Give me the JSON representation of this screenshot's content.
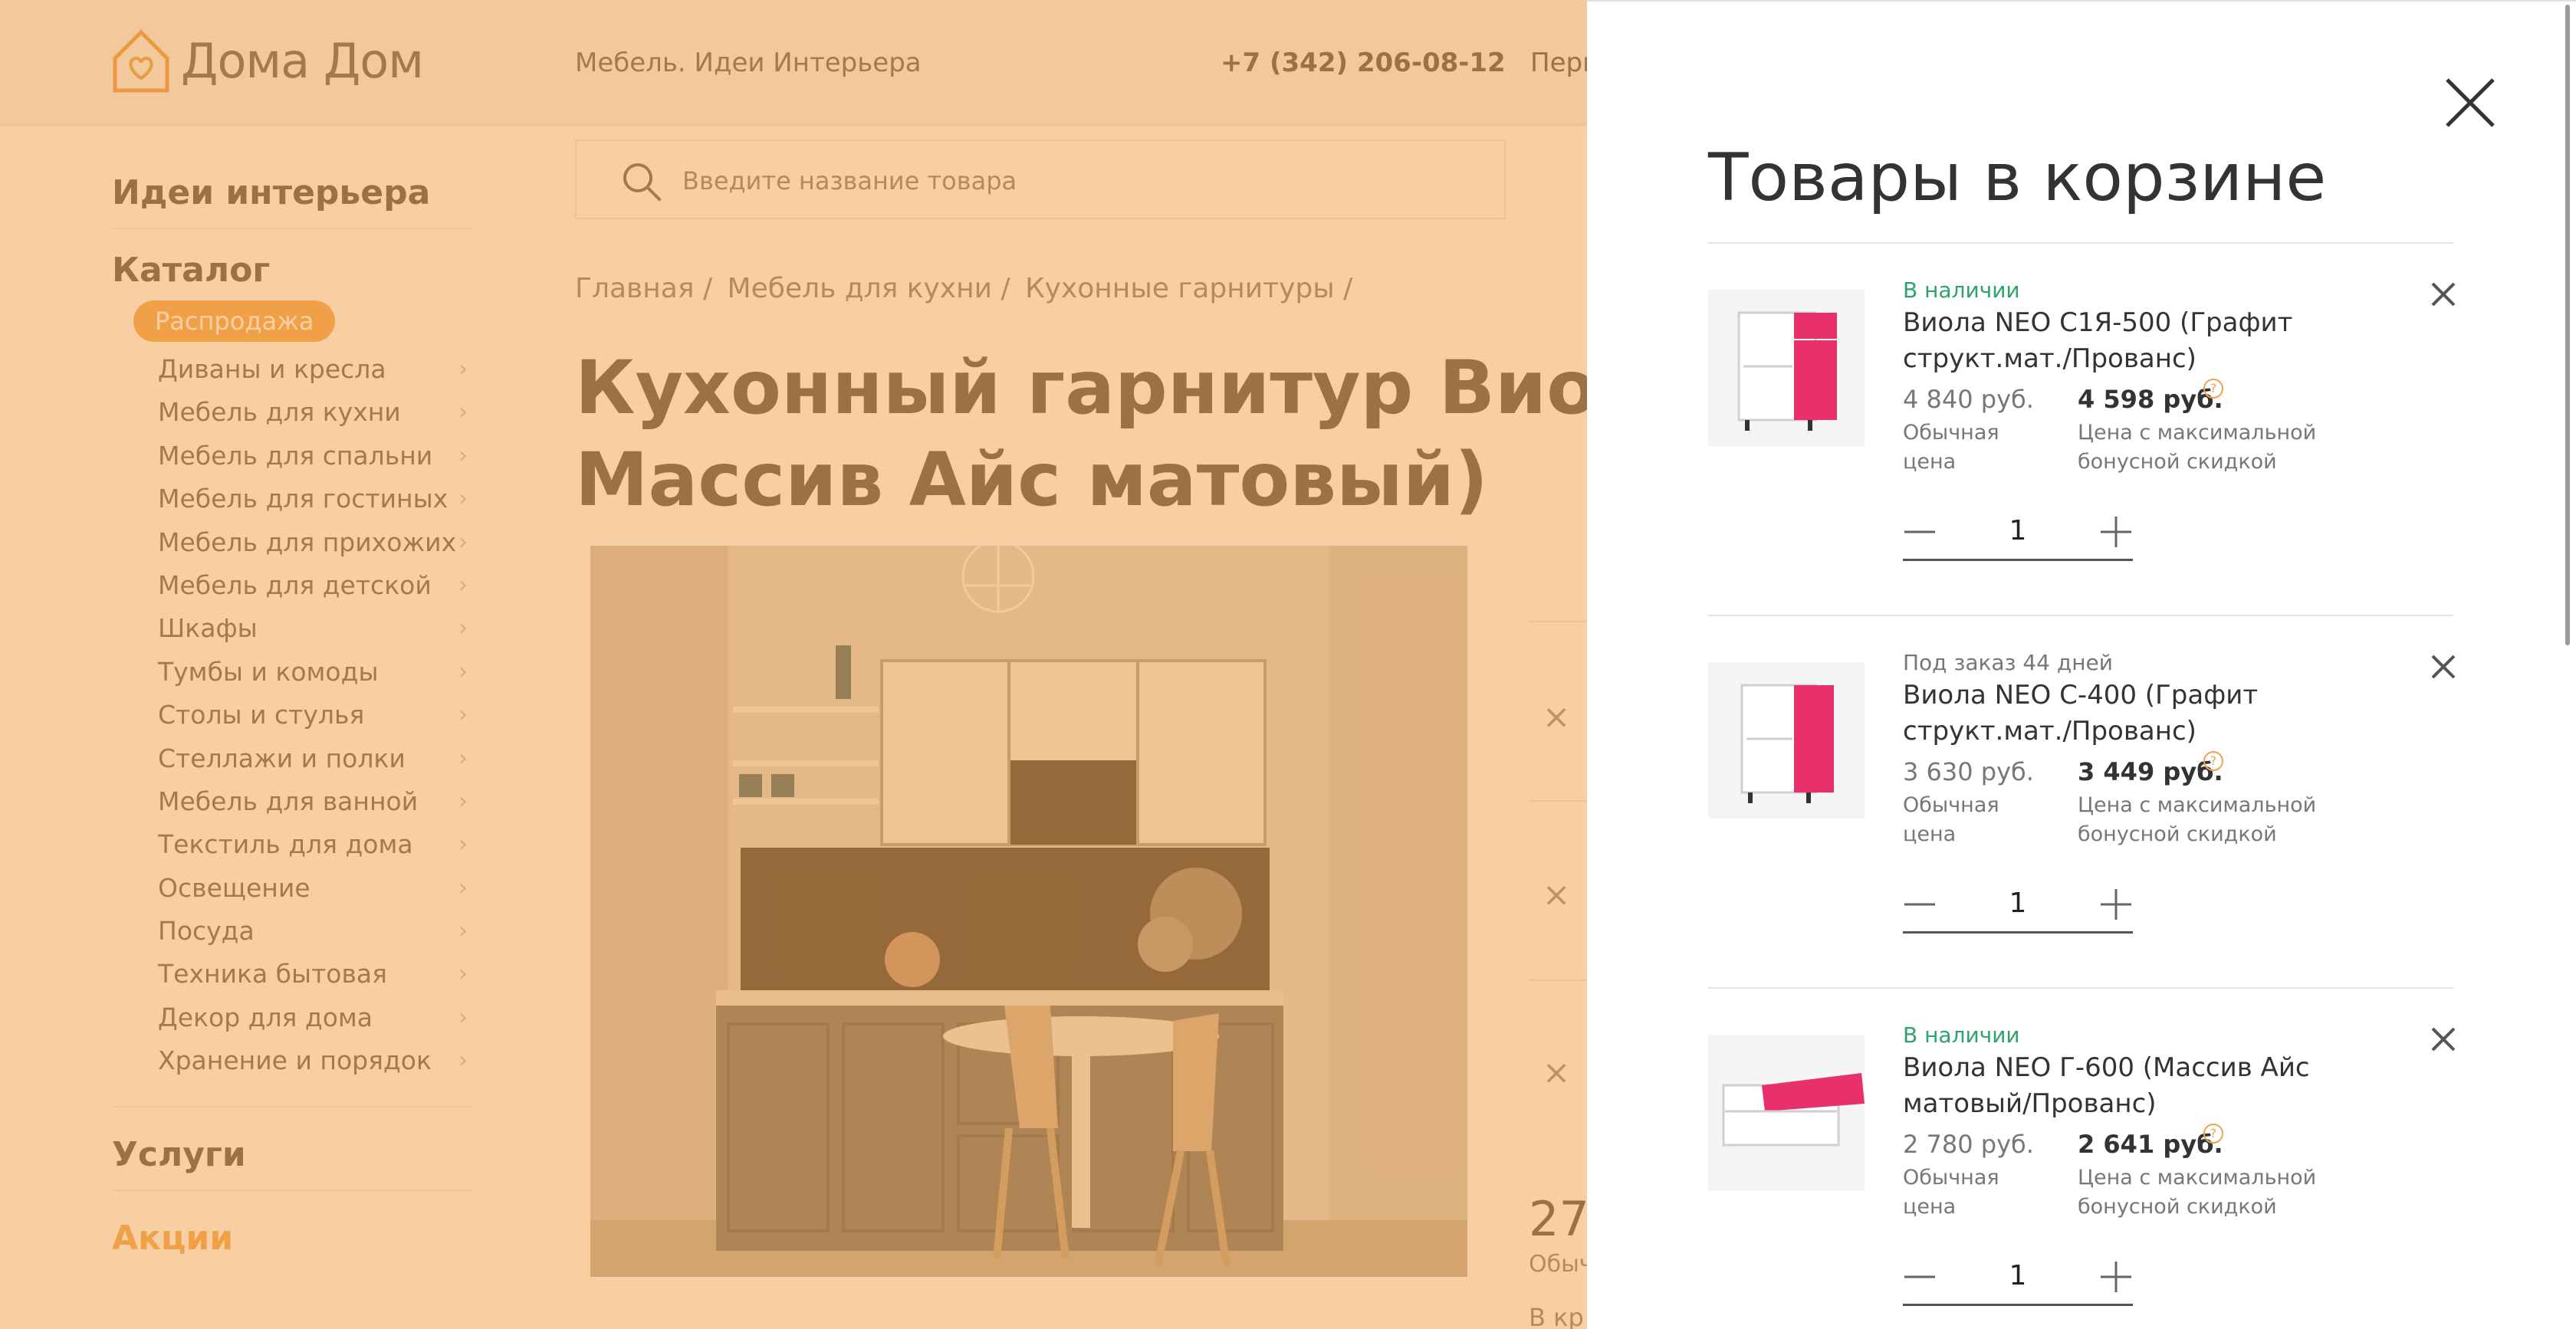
{
  "header": {
    "logo_text": "Дома Дом",
    "slogan": "Мебель. Идеи Интерьера",
    "phone": "+7 (342) 206-08-12",
    "city": "Перм"
  },
  "search": {
    "placeholder": "Введите название товара"
  },
  "sidebar": {
    "ideas": "Идеи интерьера",
    "catalog": "Каталог",
    "sale": "Распродажа",
    "categories": [
      "Диваны и кресла",
      "Мебель для кухни",
      "Мебель для спальни",
      "Мебель для гостиных",
      "Мебель для прихожих",
      "Мебель для детской",
      "Шкафы",
      "Тумбы и комоды",
      "Столы и стулья",
      "Стеллажи и полки",
      "Мебель для ванной",
      "Текстиль для дома",
      "Освещение",
      "Посуда",
      "Техника бытовая",
      "Декор для дома",
      "Хранение и порядок"
    ],
    "services": "Услуги",
    "promotions": "Акции"
  },
  "breadcrumb": [
    "Главная /",
    "Мебель для кухни /",
    "Кухонные гарнитуры /"
  ],
  "product": {
    "title_line1": "Кухонный гарнитур Виола Н",
    "title_line2": "Массив Айс матовый)",
    "price_partial": "27",
    "price_label_partial": "Обыч",
    "bottom_partial": "В кр"
  },
  "cart": {
    "title": "Товары в корзине",
    "items": [
      {
        "availability": "В наличии",
        "availability_type": "in-stock",
        "name": "Виола NEO С1Я-500 (Графит структ.мат./Прованс)",
        "price_old": "4 840 руб.",
        "price_old_label": "Обычная цена",
        "price_new": "4 598 руб.",
        "price_new_label": "Цена с максимальной бонусной скидкой",
        "quantity": "1"
      },
      {
        "availability": "Под заказ 44 дней",
        "availability_type": "on-order",
        "name": "Виола NEO С-400 (Графит структ.мат./Прованс)",
        "price_old": "3 630 руб.",
        "price_old_label": "Обычная цена",
        "price_new": "3 449 руб.",
        "price_new_label": "Цена с максимальной бонусной скидкой",
        "quantity": "1"
      },
      {
        "availability": "В наличии",
        "availability_type": "in-stock",
        "name": "Виола NEO Г-600 (Массив Айс матовый/Прованс)",
        "price_old": "2 780 руб.",
        "price_old_label": "Обычная цена",
        "price_new": "2 641 руб.",
        "price_new_label": "Цена с максимальной бонусной скидкой",
        "quantity": "1"
      }
    ]
  },
  "colors": {
    "accent": "#f0a24a",
    "overlay": "#f0a046",
    "in_stock": "#2fa46a",
    "product_pink": "#e8306a"
  },
  "icons": {
    "info": "?"
  }
}
